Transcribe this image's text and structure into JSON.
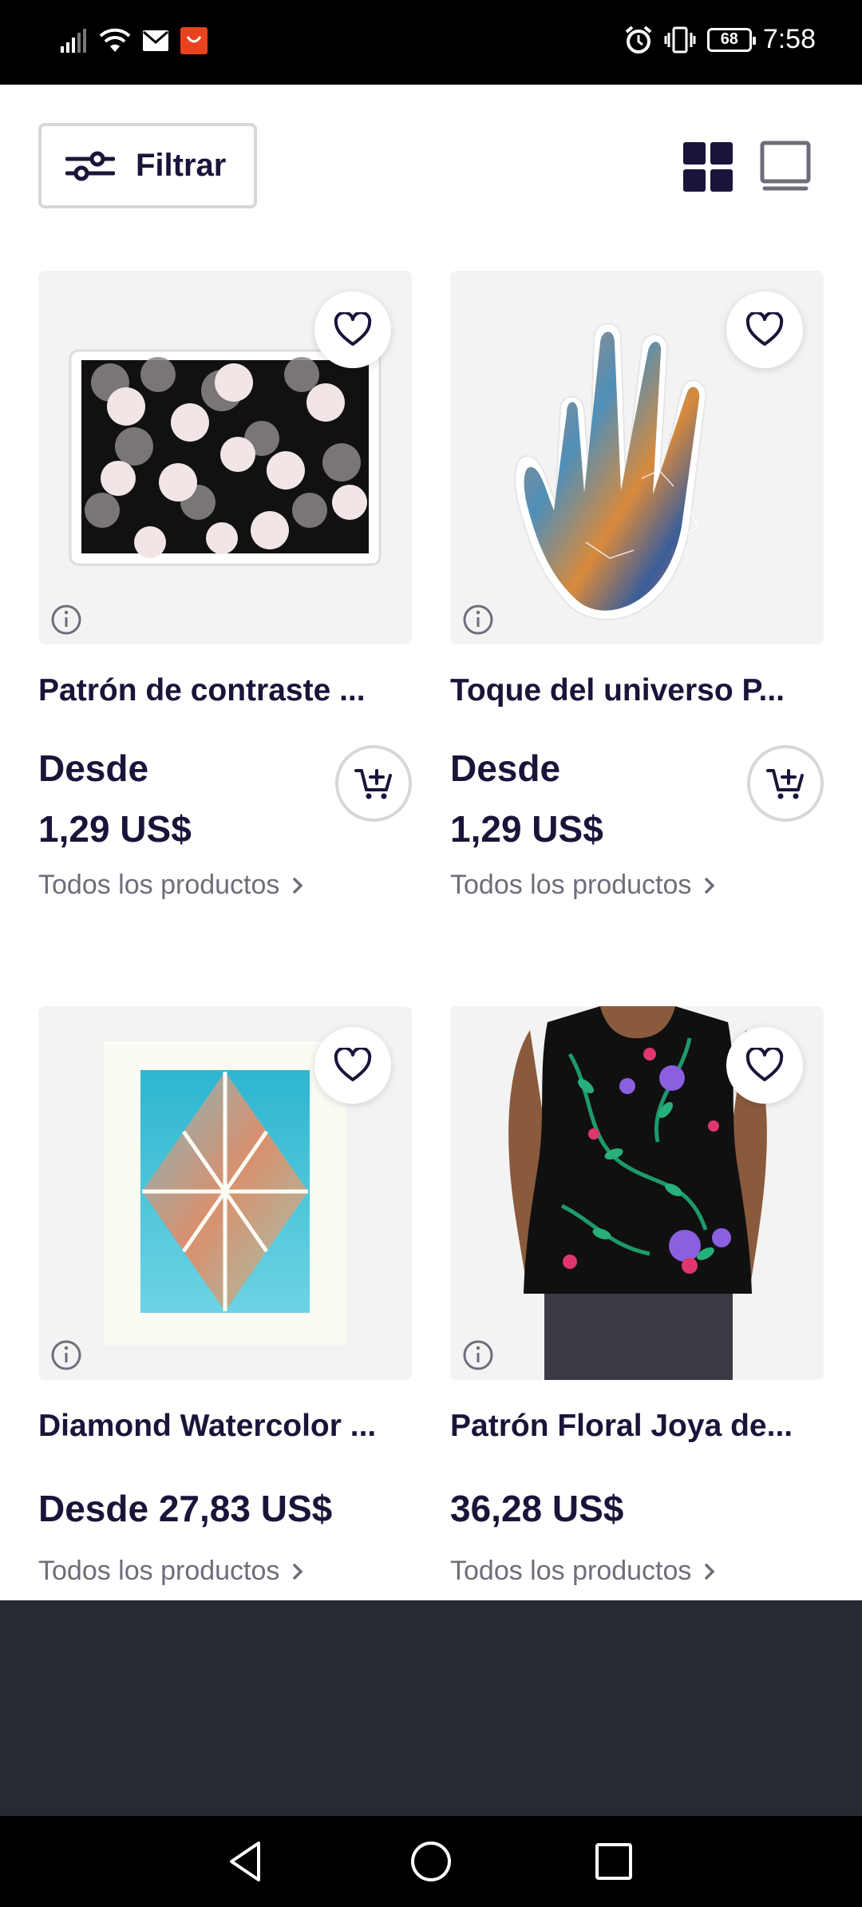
{
  "status_bar": {
    "time": "7:58",
    "battery": "68",
    "icons": [
      "signal-icon",
      "wifi-icon",
      "mail-icon",
      "app-notification-icon",
      "alarm-icon",
      "vibrate-icon",
      "battery-icon"
    ]
  },
  "toolbar": {
    "filter_label": "Filtrar",
    "filter_icon": "sliders-icon",
    "grid_view_icon": "grid-view-icon",
    "list_view_icon": "single-view-icon"
  },
  "products": [
    {
      "title": "Patrón de contraste ...",
      "price_prefix": "Desde",
      "price": "1,29 US$",
      "link": "Todos los productos",
      "has_cart": true
    },
    {
      "title": "Toque del universo P...",
      "price_prefix": "Desde",
      "price": "1,29 US$",
      "link": "Todos los productos",
      "has_cart": true
    },
    {
      "title": "Diamond Watercolor ...",
      "price": "Desde 27,83 US$",
      "link": "Todos los productos",
      "has_cart": false
    },
    {
      "title": "Patrón Floral Joya de...",
      "price": "36,28 US$",
      "link": "Todos los productos",
      "has_cart": false
    }
  ],
  "colors": {
    "text_primary": "#19153a",
    "text_secondary": "#6e6d7a",
    "card_bg": "#f3f3f4",
    "footer_panel": "#272a33"
  }
}
